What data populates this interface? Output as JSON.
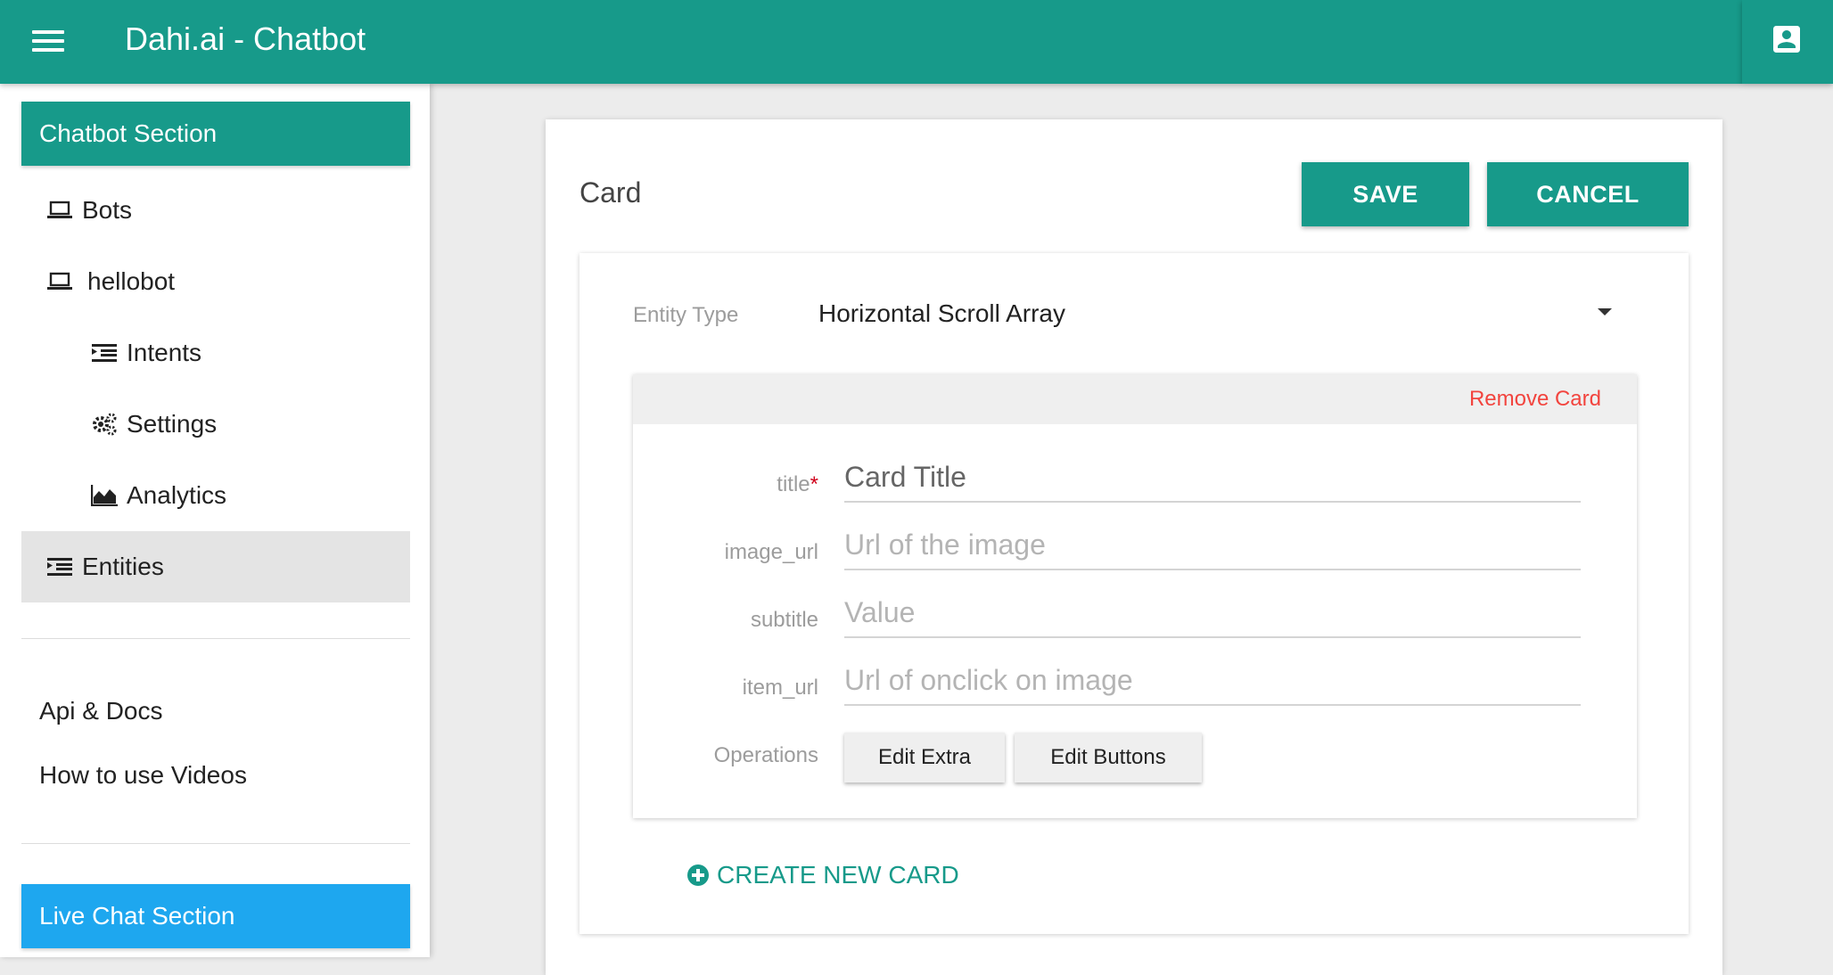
{
  "app": {
    "title": "Dahi.ai - Chatbot"
  },
  "icons": {
    "menu": "hamburger-menu-icon",
    "profile": "account-box-icon",
    "bots": "laptop-icon",
    "hellobot": "laptop-icon",
    "intents": "list-indent-icon",
    "settings": "gears-icon",
    "analytics": "area-chart-icon",
    "entities": "list-indent-icon",
    "create": "plus-circle-icon",
    "dropdown": "caret-down-icon"
  },
  "colors": {
    "primary": "#179a8a",
    "live_chat": "#1ea7ef",
    "danger": "#f2443e"
  },
  "sidebar": {
    "chatbot_section": "Chatbot Section",
    "items": [
      {
        "label": "Bots"
      },
      {
        "label": "hellobot"
      },
      {
        "label": "Intents"
      },
      {
        "label": "Settings"
      },
      {
        "label": "Analytics"
      },
      {
        "label": "Entities",
        "active": true
      }
    ],
    "links": [
      {
        "label": "Api & Docs"
      },
      {
        "label": "How to use Videos"
      }
    ],
    "live_chat_section": "Live Chat Section"
  },
  "panel": {
    "title": "Card",
    "save_label": "SAVE",
    "cancel_label": "CANCEL",
    "entity_type_label": "Entity Type",
    "entity_type_value": "Horizontal Scroll Array",
    "card": {
      "remove_label": "Remove Card",
      "fields": [
        {
          "label": "title",
          "required_mark": "*",
          "placeholder": "Card Title",
          "value": ""
        },
        {
          "label": "image_url",
          "placeholder": "Url of the image",
          "value": ""
        },
        {
          "label": "subtitle",
          "placeholder": "Value",
          "value": ""
        },
        {
          "label": "item_url",
          "placeholder": "Url of onclick on image",
          "value": ""
        }
      ],
      "operations_label": "Operations",
      "edit_extra_label": "Edit Extra",
      "edit_buttons_label": "Edit Buttons"
    },
    "create_new_card_label": "CREATE NEW CARD"
  }
}
